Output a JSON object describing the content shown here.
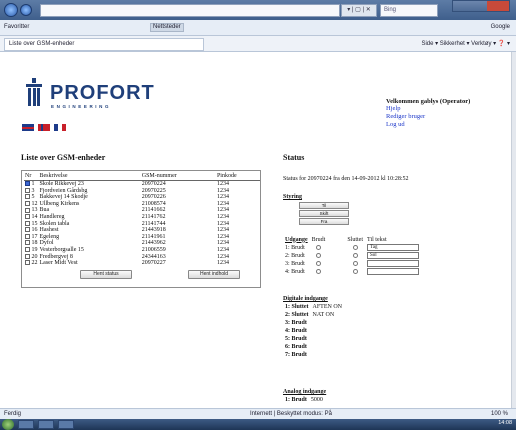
{
  "browser": {
    "address_tools": "▾ | ▢ | ✕",
    "search_text": "Bing",
    "favorites_label": "Favoritter",
    "fav_toolbar": "Nettsteder",
    "fav_right": "Google",
    "tab_title": "Liste over GSM-enheder",
    "cmd_tools": "Side ▾  Sikkerhet ▾  Verktøy ▾  ❓ ▾",
    "status_left": "Ferdig",
    "status_middle": "Internett | Beskyttet modus: På",
    "status_right": "100 %",
    "taskbar_clock": "14:08"
  },
  "logo": {
    "name": "PROFORT",
    "tagline": "ENGINEERING"
  },
  "welcome": {
    "title": "Velkommen gablys (Operator)",
    "links": [
      "Hjelp",
      "Rediger bruger",
      "Log ud"
    ]
  },
  "units_section": {
    "title": "Liste over GSM-enheder",
    "columns": [
      "Nr",
      "Beskrivelse",
      "GSM-nummer",
      "Pinkode"
    ],
    "rows": [
      {
        "nr": "1",
        "desc": "Skole Rikkevej 23",
        "gsm": "20970224",
        "pin": "1234",
        "checked": true
      },
      {
        "nr": "3",
        "desc": "Fjordveien Gårdsbg",
        "gsm": "20970225",
        "pin": "1234",
        "checked": false
      },
      {
        "nr": "5",
        "desc": "Bakkevej 14 Skodje",
        "gsm": "20970226",
        "pin": "1234",
        "checked": false
      },
      {
        "nr": "12",
        "desc": "Ullbeng Kirkens",
        "gsm": "21008574",
        "pin": "1234",
        "checked": false
      },
      {
        "nr": "13",
        "desc": "Bua",
        "gsm": "21141662",
        "pin": "1234",
        "checked": false
      },
      {
        "nr": "14",
        "desc": "Handlereg",
        "gsm": "21141762",
        "pin": "1234",
        "checked": false
      },
      {
        "nr": "15",
        "desc": "Skolen tabla",
        "gsm": "21141744",
        "pin": "1234",
        "checked": false
      },
      {
        "nr": "16",
        "desc": "Hashest",
        "gsm": "21443918",
        "pin": "1234",
        "checked": false
      },
      {
        "nr": "17",
        "desc": "Egeleng",
        "gsm": "21141961",
        "pin": "1234",
        "checked": false
      },
      {
        "nr": "18",
        "desc": "Dyfol",
        "gsm": "21443962",
        "pin": "1234",
        "checked": false
      },
      {
        "nr": "19",
        "desc": "Vesterborgsalle 15",
        "gsm": "21006559",
        "pin": "1234",
        "checked": false
      },
      {
        "nr": "20",
        "desc": "Fredbergvej 8",
        "gsm": "24344163",
        "pin": "1234",
        "checked": false
      },
      {
        "nr": "22",
        "desc": "Laser Midt Vest",
        "gsm": "20970227",
        "pin": "1234",
        "checked": false
      }
    ],
    "btn_status": "Hent status",
    "btn_config": "Hent indhold"
  },
  "status_section": {
    "title": "Status",
    "status_line": "Status for 20970224 fra den 14-09-2012 kl 10:28:52",
    "control": {
      "title": "Styring",
      "buttons": [
        "Til",
        "Skift",
        "Fra"
      ]
    },
    "outputs": {
      "title": "Udgange",
      "col_on": "Brudt",
      "col_off": "Sluttet",
      "col_text": "Til tekst",
      "rows": [
        {
          "label": "1: Brudt",
          "text": "Tag"
        },
        {
          "label": "2: Brudt",
          "text": "Sol"
        },
        {
          "label": "3: Brudt",
          "text": ""
        },
        {
          "label": "4: Brudt",
          "text": ""
        }
      ]
    },
    "digital_inputs": {
      "title": "Digitale indgange",
      "rows": [
        {
          "label": "1: Sluttet",
          "value": "AFTEN ON"
        },
        {
          "label": "2: Sluttet",
          "value": "NAT ON"
        },
        {
          "label": "3: Brudt",
          "value": ""
        },
        {
          "label": "4: Brudt",
          "value": ""
        },
        {
          "label": "5: Brudt",
          "value": ""
        },
        {
          "label": "6: Brudt",
          "value": ""
        },
        {
          "label": "7: Brudt",
          "value": ""
        }
      ]
    },
    "analog_inputs": {
      "title": "Analog indgange",
      "rows": [
        {
          "label": "1: Brudt",
          "value": "5000"
        }
      ]
    }
  }
}
